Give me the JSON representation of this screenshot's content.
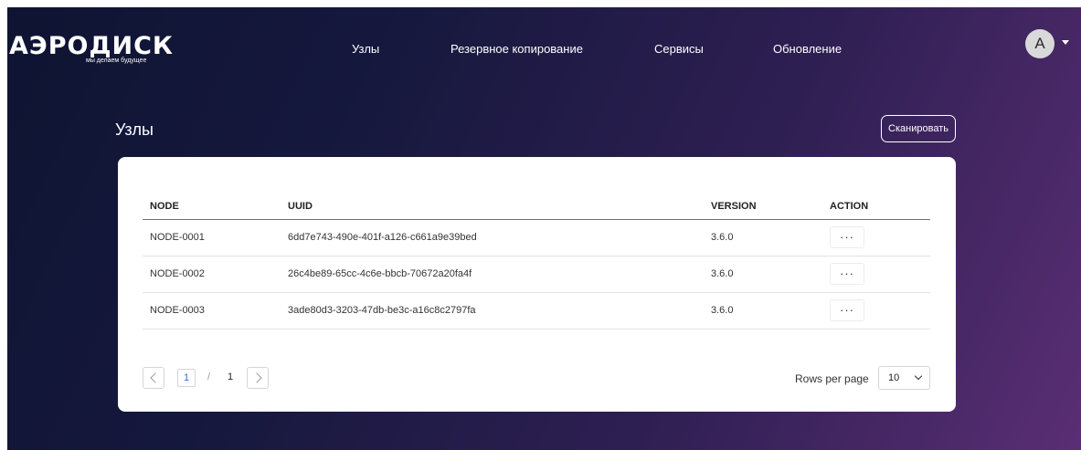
{
  "brand": {
    "logo_text": "АЭРОДИСК",
    "tagline": "мы делаем будущее"
  },
  "nav": {
    "items": [
      {
        "label": "Узлы"
      },
      {
        "label": "Резервное копирование"
      },
      {
        "label": "Сервисы"
      },
      {
        "label": "Обновление"
      }
    ]
  },
  "user": {
    "avatar_letter": "A",
    "menu_icon": "caret-down-icon"
  },
  "page": {
    "title": "Узлы",
    "scan_label": "Сканировать"
  },
  "table": {
    "columns": [
      "NODE",
      "UUID",
      "VERSION",
      "ACTION"
    ],
    "rows": [
      {
        "node": "NODE-0001",
        "uuid": "6dd7e743-490e-401f-a126-c661a9e39bed",
        "version": "3.6.0",
        "action": "···"
      },
      {
        "node": "NODE-0002",
        "uuid": "26c4be89-65cc-4c6e-bbcb-70672a20fa4f",
        "version": "3.6.0",
        "action": "···"
      },
      {
        "node": "NODE-0003",
        "uuid": "3ade80d3-3203-47db-be3c-a16c8c2797fa",
        "version": "3.6.0",
        "action": "···"
      }
    ]
  },
  "pagination": {
    "current": "1",
    "separator": "/",
    "total": "1",
    "prev_icon": "chevron-left-icon",
    "next_icon": "chevron-right-icon",
    "rows_per_page_label": "Rows per page",
    "rows_per_page_value": "10"
  },
  "colors": {
    "background_start": "#0f1432",
    "background_end": "#5a2e74",
    "accent": "#2f6fe4"
  }
}
